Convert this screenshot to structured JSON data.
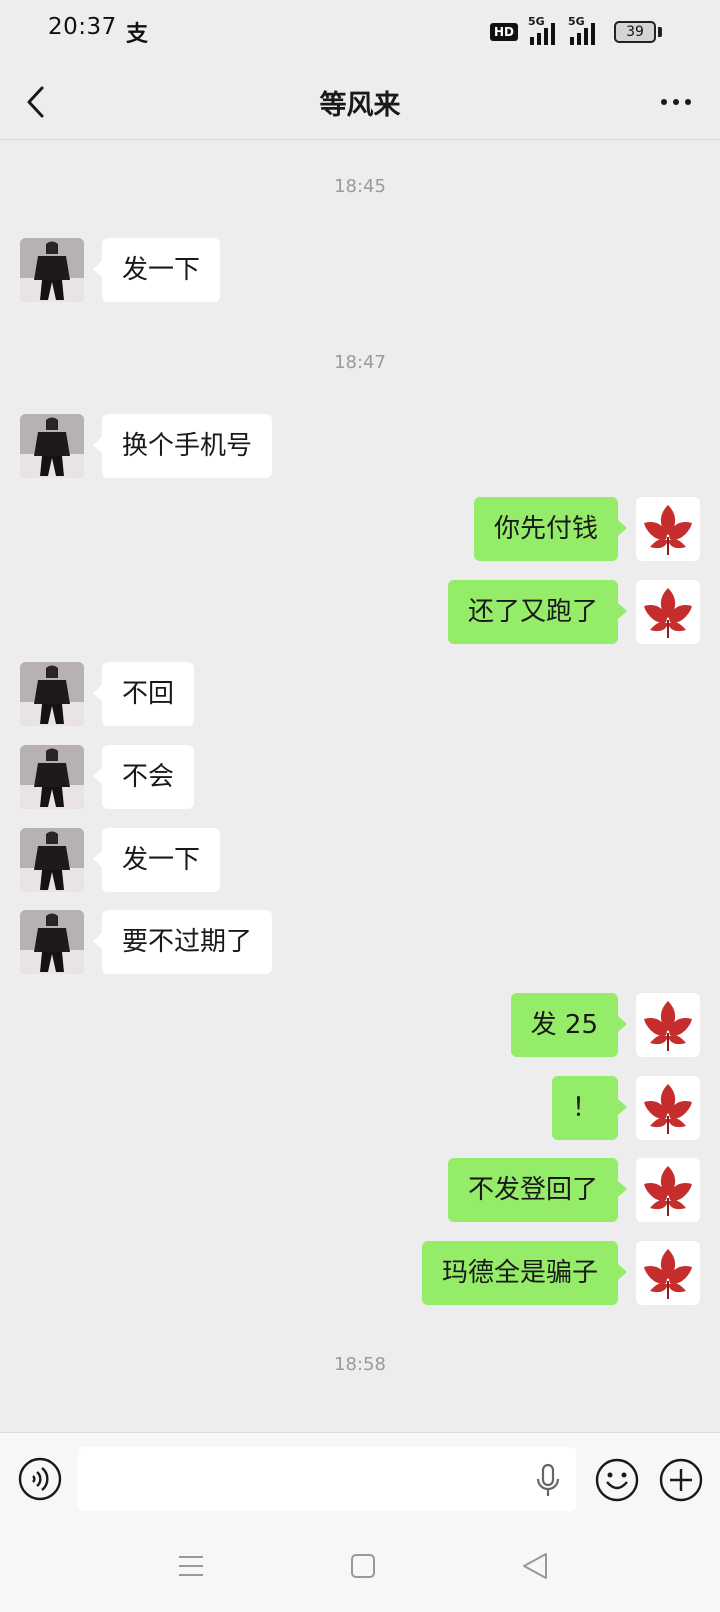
{
  "status_bar": {
    "time": "20:37",
    "app_icon_glyph": "支",
    "hd_label": "HD",
    "signal1_label": "5G",
    "signal2_label": "5G",
    "battery": "39"
  },
  "header": {
    "title": "等风来"
  },
  "timestamps": [
    "18:45",
    "18:47",
    "18:58"
  ],
  "messages": [
    {
      "side": "in",
      "text": "发一下"
    },
    {
      "side": "in",
      "text": "换个手机号"
    },
    {
      "side": "out",
      "text": "你先付钱"
    },
    {
      "side": "out",
      "text": "还了又跑了"
    },
    {
      "side": "in",
      "text": "不回"
    },
    {
      "side": "in",
      "text": "不会"
    },
    {
      "side": "in",
      "text": "发一下"
    },
    {
      "side": "in",
      "text": "要不过期了"
    },
    {
      "side": "out",
      "text": "发 25"
    },
    {
      "side": "out",
      "text": "！"
    },
    {
      "side": "out",
      "text": "不发登回了"
    },
    {
      "side": "out",
      "text": "玛德全是骗子"
    }
  ],
  "input": {
    "value": "",
    "placeholder": ""
  },
  "icons": {
    "back": "chevron-left-icon",
    "more": "more-dots-icon",
    "voice": "voice-icon",
    "mic": "mic-icon",
    "emoji": "emoji-icon",
    "plus": "plus-icon"
  },
  "colors": {
    "background": "#ededed",
    "outgoing_bubble": "#95ec69",
    "incoming_bubble": "#ffffff",
    "timestamp": "#9a9a9a",
    "leaf_avatar": "#c62d2d"
  }
}
